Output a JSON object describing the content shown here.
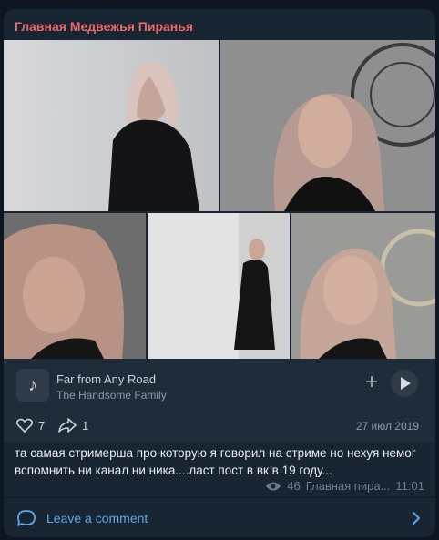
{
  "post": {
    "channel_name": "Главная Медвежья Пиранья",
    "text": "та самая стримерша про которую я говорил на стриме но нехуя немог вспомнить ни канал ни ника....ласт пост в вк в 19 году...",
    "views": "46",
    "author_short": "Главная пира...",
    "time": "11:01"
  },
  "audio": {
    "title": "Far from Any Road",
    "artist": "The Handsome Family",
    "cover_icon": "music-note-icon"
  },
  "reactions": {
    "likes": "7",
    "shares": "1",
    "date": "27 июл 2019"
  },
  "comment_bar": {
    "label": "Leave a comment"
  },
  "colors": {
    "bubble": "#182533",
    "channel_name": "#e86a6a",
    "link": "#5ea8e6",
    "muted": "#6d7f8f"
  }
}
